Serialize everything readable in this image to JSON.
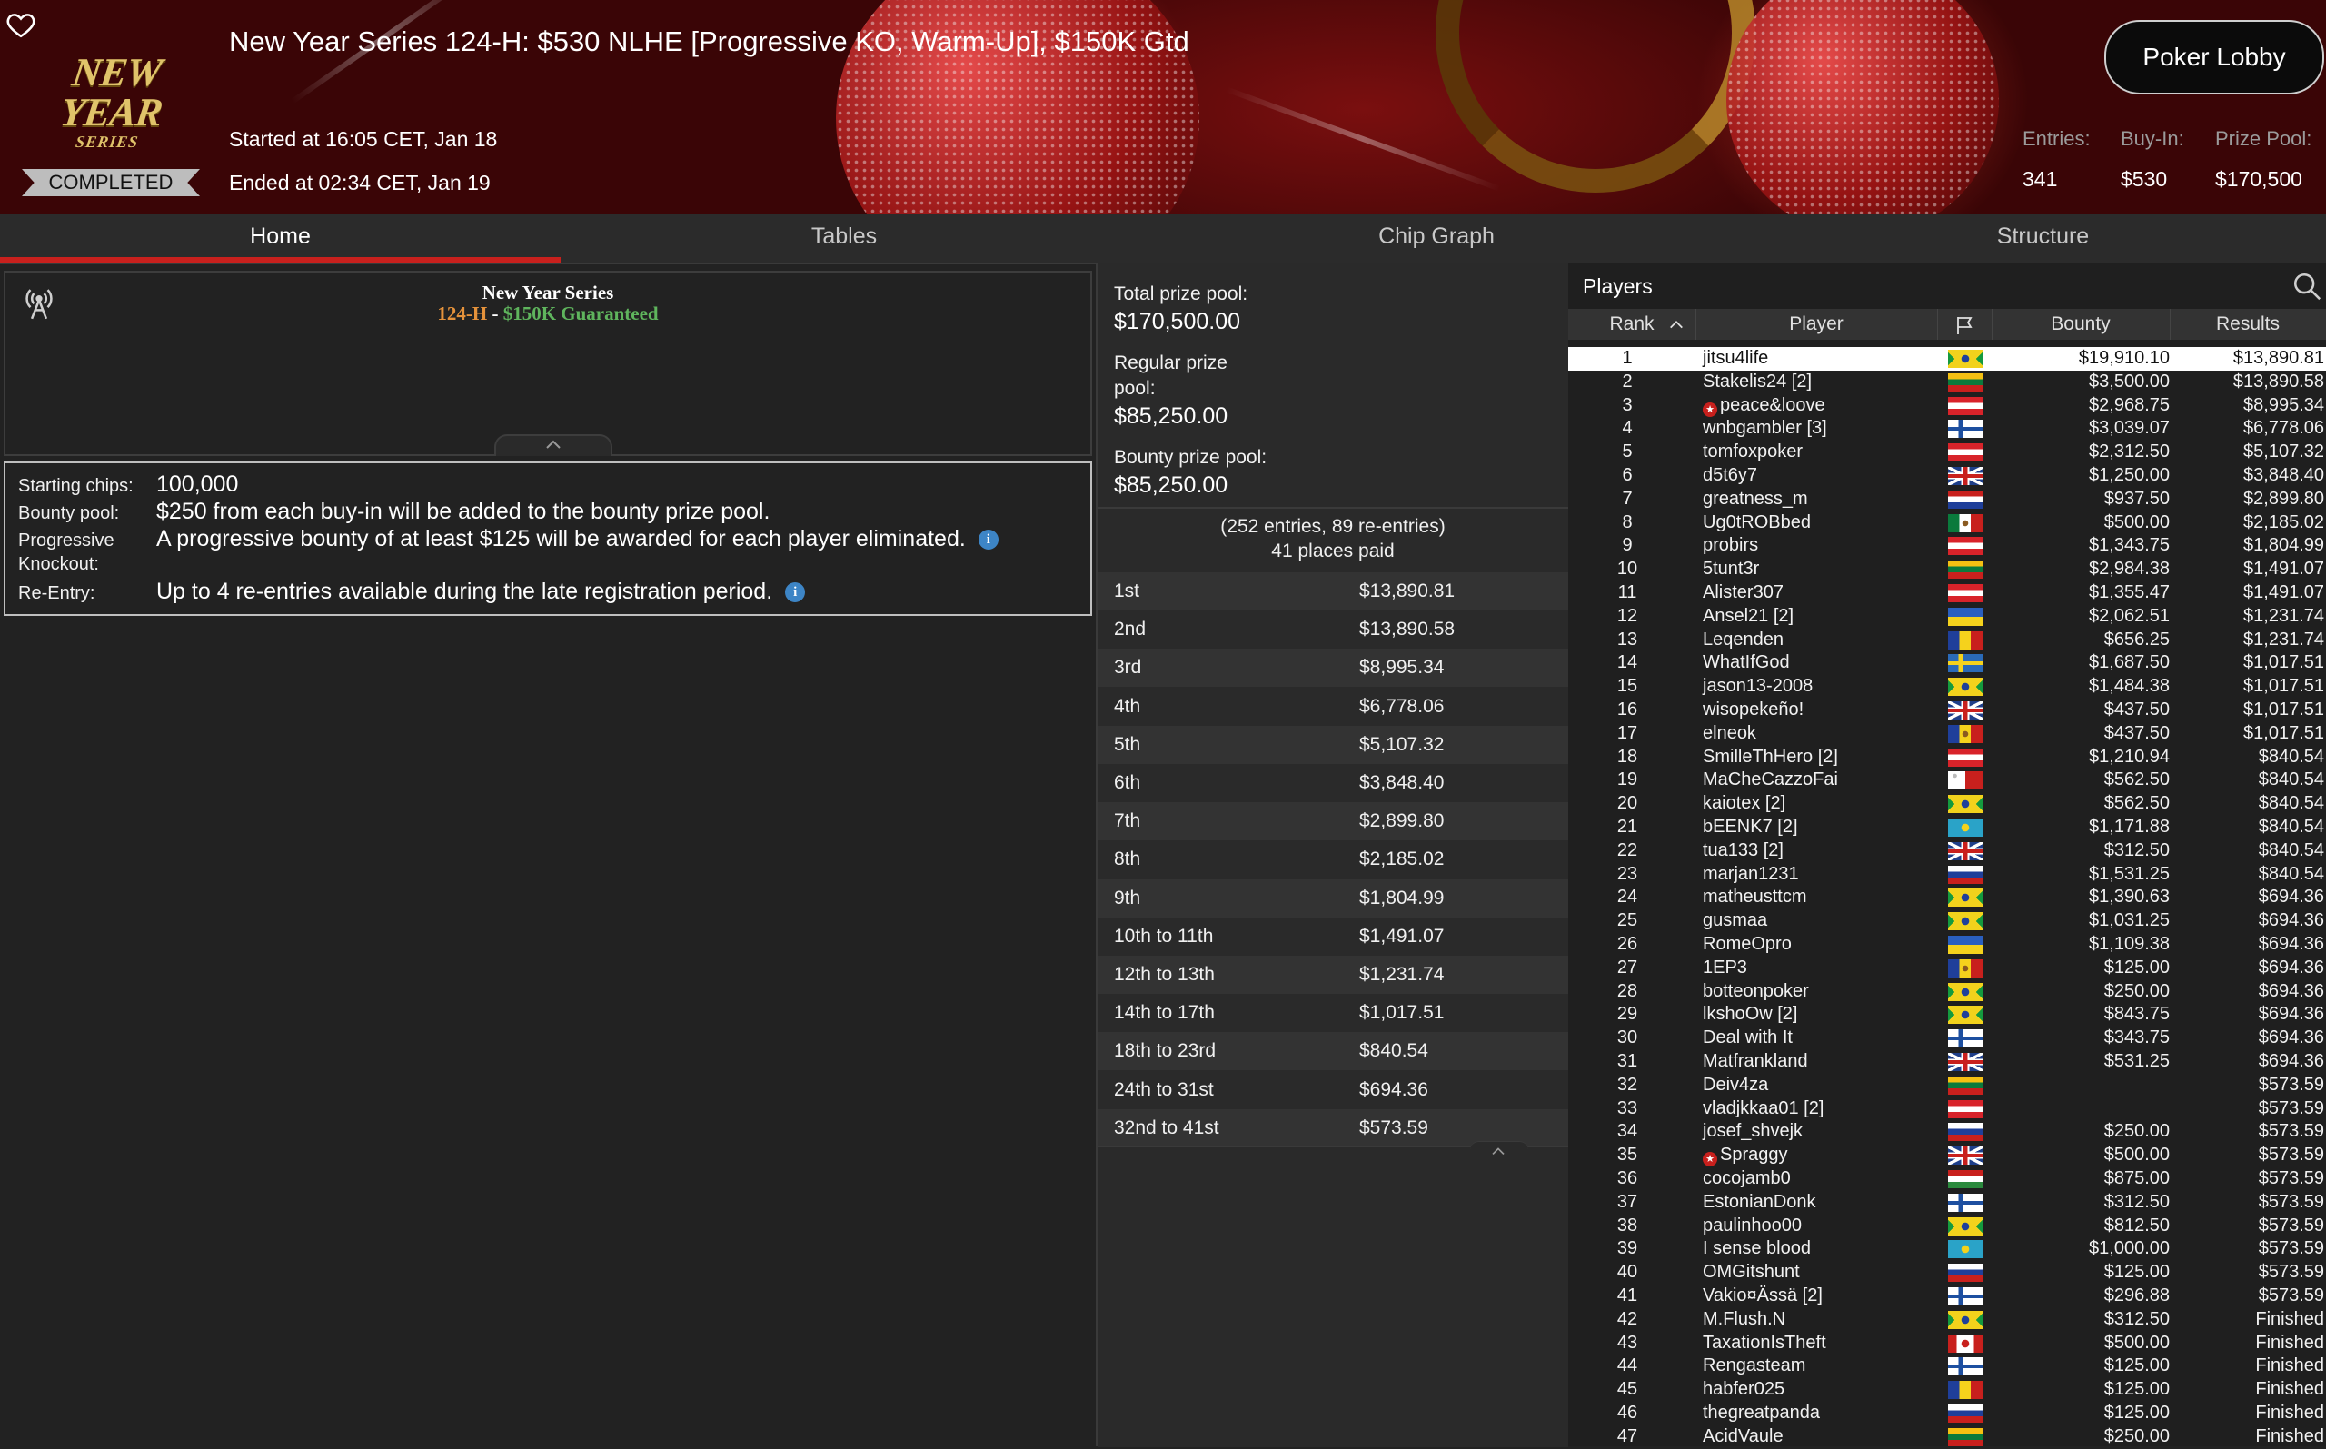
{
  "header": {
    "logo_line1": "NEW YEAR",
    "logo_line2": "SERIES",
    "status": "COMPLETED",
    "title": "New Year Series 124-H: $530 NLHE [Progressive KO, Warm-Up], $150K Gtd",
    "started": "Started at 16:05 CET, Jan 18",
    "ended": "Ended at 02:34 CET, Jan 19",
    "lobby_button": "Poker Lobby",
    "stats": [
      {
        "label": "Entries:",
        "value": "341"
      },
      {
        "label": "Buy-In:",
        "value": "$530"
      },
      {
        "label": "Prize Pool:",
        "value": "$170,500"
      }
    ]
  },
  "tabs": [
    "Home",
    "Tables",
    "Chip Graph",
    "Structure"
  ],
  "info": {
    "series_name": "New Year Series",
    "event_code": "124-H",
    "separator": " - ",
    "guarantee": "$150K Guaranteed"
  },
  "details": [
    {
      "label": "Starting chips:",
      "value": "100,000",
      "info": false
    },
    {
      "label": "Bounty pool:",
      "value": "$250 from each buy-in will be added to the bounty prize pool.",
      "info": false
    },
    {
      "label": "Progressive Knockout:",
      "value": "A progressive bounty of at least $125 will be awarded for each player eliminated.",
      "info": true
    },
    {
      "label": "Re-Entry:",
      "value": "Up to 4 re-entries available during the late registration period.",
      "info": true
    }
  ],
  "prize_pool": {
    "total_label": "Total prize pool:",
    "total_value": "$170,500.00",
    "regular_label": "Regular prize pool:",
    "regular_value": "$85,250.00",
    "bounty_label": "Bounty prize pool:",
    "bounty_value": "$85,250.00",
    "entries_line": "(252 entries, 89 re-entries)",
    "places_line": "41 places paid",
    "payouts": [
      {
        "place": "1st",
        "amount": "$13,890.81"
      },
      {
        "place": "2nd",
        "amount": "$13,890.58"
      },
      {
        "place": "3rd",
        "amount": "$8,995.34"
      },
      {
        "place": "4th",
        "amount": "$6,778.06"
      },
      {
        "place": "5th",
        "amount": "$5,107.32"
      },
      {
        "place": "6th",
        "amount": "$3,848.40"
      },
      {
        "place": "7th",
        "amount": "$2,899.80"
      },
      {
        "place": "8th",
        "amount": "$2,185.02"
      },
      {
        "place": "9th",
        "amount": "$1,804.99"
      },
      {
        "place": "10th to 11th",
        "amount": "$1,491.07"
      },
      {
        "place": "12th to 13th",
        "amount": "$1,231.74"
      },
      {
        "place": "14th to 17th",
        "amount": "$1,017.51"
      },
      {
        "place": "18th to 23rd",
        "amount": "$840.54"
      },
      {
        "place": "24th to 31st",
        "amount": "$694.36"
      },
      {
        "place": "32nd to 41st",
        "amount": "$573.59"
      }
    ]
  },
  "players": {
    "title": "Players",
    "columns": {
      "rank": "Rank",
      "player": "Player",
      "bounty": "Bounty",
      "results": "Results"
    },
    "rows": [
      {
        "rank": "1",
        "name": "jitsu4life",
        "bounty": "$19,910.10",
        "result": "$13,890.81",
        "flag": "br"
      },
      {
        "rank": "2",
        "name": "Stakelis24 [2]",
        "bounty": "$3,500.00",
        "result": "$13,890.58",
        "flag": "lt"
      },
      {
        "rank": "3",
        "name": "peace&loove",
        "bounty": "$2,968.75",
        "result": "$8,995.34",
        "flag": "at",
        "star": true
      },
      {
        "rank": "4",
        "name": "wnbgambler [3]",
        "bounty": "$3,039.07",
        "result": "$6,778.06",
        "flag": "fi"
      },
      {
        "rank": "5",
        "name": "tomfoxpoker",
        "bounty": "$2,312.50",
        "result": "$5,107.32",
        "flag": "at"
      },
      {
        "rank": "6",
        "name": "d5t6y7",
        "bounty": "$1,250.00",
        "result": "$3,848.40",
        "flag": "gb"
      },
      {
        "rank": "7",
        "name": "greatness_m",
        "bounty": "$937.50",
        "result": "$2,899.80",
        "flag": "nl"
      },
      {
        "rank": "8",
        "name": "Ug0tROBbed",
        "bounty": "$500.00",
        "result": "$2,185.02",
        "flag": "mx"
      },
      {
        "rank": "9",
        "name": "probirs",
        "bounty": "$1,343.75",
        "result": "$1,804.99",
        "flag": "at"
      },
      {
        "rank": "10",
        "name": "5tunt3r",
        "bounty": "$2,984.38",
        "result": "$1,491.07",
        "flag": "lt"
      },
      {
        "rank": "11",
        "name": "Alister307",
        "bounty": "$1,355.47",
        "result": "$1,491.07",
        "flag": "at"
      },
      {
        "rank": "12",
        "name": "Ansel21 [2]",
        "bounty": "$2,062.51",
        "result": "$1,231.74",
        "flag": "ua"
      },
      {
        "rank": "13",
        "name": "Leqenden",
        "bounty": "$656.25",
        "result": "$1,231.74",
        "flag": "ro"
      },
      {
        "rank": "14",
        "name": "WhatIfGod",
        "bounty": "$1,687.50",
        "result": "$1,017.51",
        "flag": "se"
      },
      {
        "rank": "15",
        "name": "jason13-2008",
        "bounty": "$1,484.38",
        "result": "$1,017.51",
        "flag": "br"
      },
      {
        "rank": "16",
        "name": "wisopekeño!",
        "bounty": "$437.50",
        "result": "$1,017.51",
        "flag": "gb"
      },
      {
        "rank": "17",
        "name": "elneok",
        "bounty": "$437.50",
        "result": "$1,017.51",
        "flag": "md"
      },
      {
        "rank": "18",
        "name": "SmilleThHero [2]",
        "bounty": "$1,210.94",
        "result": "$840.54",
        "flag": "at"
      },
      {
        "rank": "19",
        "name": "MaCheCazzoFai",
        "bounty": "$562.50",
        "result": "$840.54",
        "flag": "mt"
      },
      {
        "rank": "20",
        "name": "kaiotex [2]",
        "bounty": "$562.50",
        "result": "$840.54",
        "flag": "br"
      },
      {
        "rank": "21",
        "name": "bEENK7 [2]",
        "bounty": "$1,171.88",
        "result": "$840.54",
        "flag": "kz"
      },
      {
        "rank": "22",
        "name": "tua133 [2]",
        "bounty": "$312.50",
        "result": "$840.54",
        "flag": "gb"
      },
      {
        "rank": "23",
        "name": "marjan1231",
        "bounty": "$1,531.25",
        "result": "$840.54",
        "flag": "si"
      },
      {
        "rank": "24",
        "name": "matheusttcm",
        "bounty": "$1,390.63",
        "result": "$694.36",
        "flag": "br"
      },
      {
        "rank": "25",
        "name": "gusmaa",
        "bounty": "$1,031.25",
        "result": "$694.36",
        "flag": "br"
      },
      {
        "rank": "26",
        "name": "RomeOpro",
        "bounty": "$1,109.38",
        "result": "$694.36",
        "flag": "ua"
      },
      {
        "rank": "27",
        "name": "1EP3",
        "bounty": "$125.00",
        "result": "$694.36",
        "flag": "md"
      },
      {
        "rank": "28",
        "name": "botteonpoker",
        "bounty": "$250.00",
        "result": "$694.36",
        "flag": "br"
      },
      {
        "rank": "29",
        "name": "lkshoOw [2]",
        "bounty": "$843.75",
        "result": "$694.36",
        "flag": "br"
      },
      {
        "rank": "30",
        "name": "Deal with It",
        "bounty": "$343.75",
        "result": "$694.36",
        "flag": "fi"
      },
      {
        "rank": "31",
        "name": "Matfrankland",
        "bounty": "$531.25",
        "result": "$694.36",
        "flag": "gb"
      },
      {
        "rank": "32",
        "name": "Deiv4za",
        "bounty": "",
        "result": "$573.59",
        "flag": "lt"
      },
      {
        "rank": "33",
        "name": "vladjkkaa01 [2]",
        "bounty": "",
        "result": "$573.59",
        "flag": "at"
      },
      {
        "rank": "34",
        "name": "josef_shvejk",
        "bounty": "$250.00",
        "result": "$573.59",
        "flag": "si"
      },
      {
        "rank": "35",
        "name": "Spraggy",
        "bounty": "$500.00",
        "result": "$573.59",
        "flag": "gb",
        "star": true
      },
      {
        "rank": "36",
        "name": "cocojamb0",
        "bounty": "$875.00",
        "result": "$573.59",
        "flag": "hu"
      },
      {
        "rank": "37",
        "name": "EstonianDonk",
        "bounty": "$312.50",
        "result": "$573.59",
        "flag": "fi"
      },
      {
        "rank": "38",
        "name": "paulinhoo00",
        "bounty": "$812.50",
        "result": "$573.59",
        "flag": "br"
      },
      {
        "rank": "39",
        "name": "I sense blood",
        "bounty": "$1,000.00",
        "result": "$573.59",
        "flag": "kz"
      },
      {
        "rank": "40",
        "name": "OMGitshunt",
        "bounty": "$125.00",
        "result": "$573.59",
        "flag": "si"
      },
      {
        "rank": "41",
        "name": "Vakio¤Ässä [2]",
        "bounty": "$296.88",
        "result": "$573.59",
        "flag": "fi"
      },
      {
        "rank": "42",
        "name": "M.Flush.N",
        "bounty": "$312.50",
        "result": "Finished",
        "flag": "br"
      },
      {
        "rank": "43",
        "name": "TaxationIsTheft",
        "bounty": "$500.00",
        "result": "Finished",
        "flag": "ca"
      },
      {
        "rank": "44",
        "name": "Rengasteam",
        "bounty": "$125.00",
        "result": "Finished",
        "flag": "fi"
      },
      {
        "rank": "45",
        "name": "habfer025",
        "bounty": "$125.00",
        "result": "Finished",
        "flag": "ro"
      },
      {
        "rank": "46",
        "name": "thegreatpanda",
        "bounty": "$125.00",
        "result": "Finished",
        "flag": "si"
      },
      {
        "rank": "47",
        "name": "AcidVaule",
        "bounty": "$250.00",
        "result": "Finished",
        "flag": "lt"
      }
    ]
  },
  "colors": {
    "accent_red": "#c8201d",
    "event_orange": "#e5923b",
    "guarantee_green": "#5fb55d",
    "info_blue": "#3d85c6"
  }
}
